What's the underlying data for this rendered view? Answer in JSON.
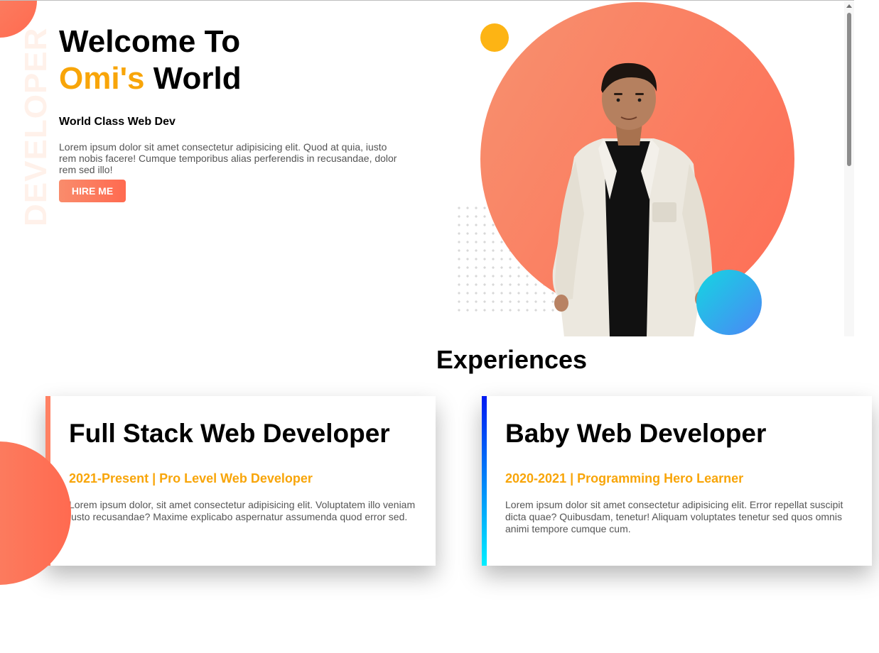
{
  "hero": {
    "vertical_word": "DEVELOPER",
    "title_line1": "Welcome To",
    "title_name": "Omi's",
    "title_rest": "World",
    "subtitle": "World Class Web Dev",
    "description": "Lorem ipsum dolor sit amet consectetur adipisicing elit. Quod at quia, iusto rem nobis facere! Cumque temporibus alias perferendis in recusandae, dolor rem sed illo!",
    "hire_label": "HIRE ME"
  },
  "experiences": {
    "section_title": "Experiences",
    "cards": [
      {
        "title": "Full Stack Web Developer",
        "meta": "2021-Present | Pro Level Web Developer",
        "body": "Lorem ipsum dolor, sit amet consectetur adipisicing elit. Voluptatem illo veniam iusto recusandae? Maxime explicabo aspernatur assumenda quod error sed."
      },
      {
        "title": "Baby Web Developer",
        "meta": "2020-2021 | Programming Hero Learner",
        "body": "Lorem ipsum dolor sit amet consectetur adipisicing elit. Error repellat suscipit dicta quae? Quibusdam, tenetur! Aliquam voluptates tenetur sed quos omnis animi tempore cumque cum."
      }
    ]
  },
  "colors": {
    "accent_orange": "#f8a509",
    "coral": "#ff6a50",
    "blue_gradient_start": "#0018f2",
    "blue_gradient_end": "#00f0ff"
  }
}
